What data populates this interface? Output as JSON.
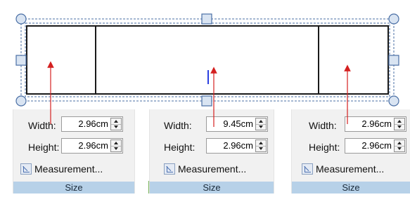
{
  "panels": [
    {
      "width_label": "Width:",
      "width_value": "2.96cm",
      "height_label": "Height:",
      "height_value": "2.96cm",
      "measurement_label": "Measurement...",
      "group_label": "Size"
    },
    {
      "width_label": "Width:",
      "width_value": "9.45cm",
      "height_label": "Height:",
      "height_value": "2.96cm",
      "measurement_label": "Measurement...",
      "group_label": "Size"
    },
    {
      "width_label": "Width:",
      "width_value": "2.96cm",
      "height_label": "Height:",
      "height_value": "2.96cm",
      "measurement_label": "Measurement...",
      "group_label": "Size"
    }
  ],
  "colors": {
    "selection": "#4a6fa5",
    "handle_fill": "#d9e4f2",
    "arrow": "#d42020",
    "caret": "#2b3fe0",
    "size_band": "#b7d1e8"
  },
  "icons": [
    "measurement-icon",
    "spin-up-icon",
    "spin-down-icon",
    "resize-handle",
    "red-arrow",
    "text-cursor"
  ]
}
